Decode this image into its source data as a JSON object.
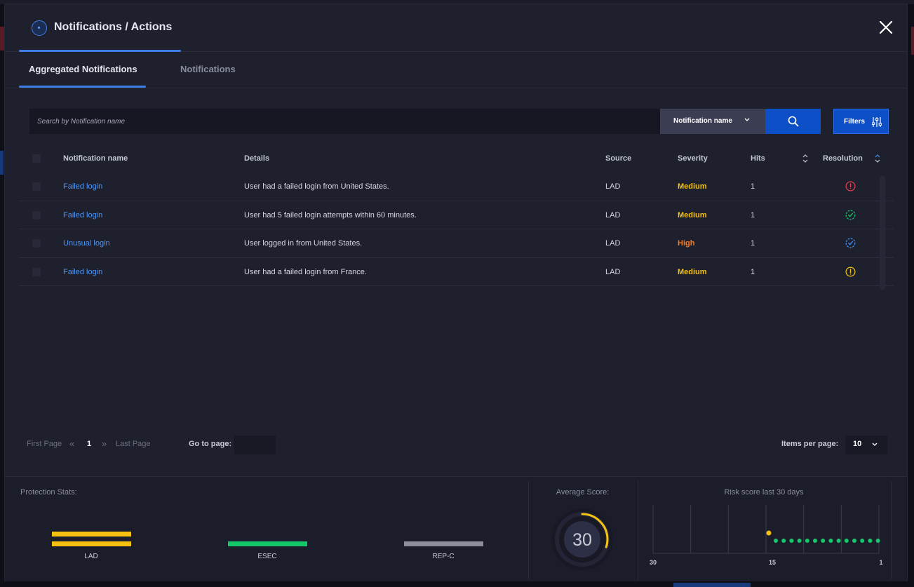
{
  "header": {
    "title": "Notifications / Actions"
  },
  "tabs": [
    {
      "label": "Aggregated Notifications",
      "active": true
    },
    {
      "label": "Notifications",
      "active": false
    }
  ],
  "search": {
    "placeholder": "Search by Notification name",
    "field_select": "Notification name",
    "filters_label": "Filters"
  },
  "table": {
    "columns": {
      "name": "Notification name",
      "details": "Details",
      "source": "Source",
      "severity": "Severity",
      "hits": "Hits",
      "resolution": "Resolution"
    },
    "rows": [
      {
        "name": "Failed login",
        "details": "User had a failed login from United States.",
        "source": "LAD",
        "severity": "Medium",
        "hits": "1",
        "resolution_icon": "alert-circle-icon",
        "resolution_color": "#e0434f"
      },
      {
        "name": "Failed login",
        "details": "User had 5 failed login attempts within 60 minutes.",
        "source": "LAD",
        "severity": "Medium",
        "hits": "1",
        "resolution_icon": "check-circle-dashed-icon",
        "resolution_color": "#19c26a"
      },
      {
        "name": "Unusual login",
        "details": "User logged in from United States.",
        "source": "LAD",
        "severity": "High",
        "hits": "1",
        "resolution_icon": "check-circle-dashed-icon",
        "resolution_color": "#3d8ff0"
      },
      {
        "name": "Failed login",
        "details": "User had a failed login from France.",
        "source": "LAD",
        "severity": "Medium",
        "hits": "1",
        "resolution_icon": "alert-circle-icon",
        "resolution_color": "#f2c811"
      }
    ],
    "severity_colors": {
      "Medium": "#f5c211",
      "High": "#f57c1f"
    }
  },
  "pagination": {
    "first_label": "First Page",
    "current_page": "1",
    "last_label": "Last Page",
    "goto_label": "Go to page:",
    "items_label": "Items per page:",
    "items_value": "10"
  },
  "stats": {
    "protection_label": "Protection Stats:",
    "bars": [
      {
        "label": "LAD",
        "color": "#f5c211",
        "double": true
      },
      {
        "label": "ESEC",
        "color": "#14c76a",
        "double": false
      },
      {
        "label": "REP-C",
        "color": "#8c8e99",
        "double": false
      }
    ],
    "average_label": "Average Score:",
    "average_score": "30",
    "average_fraction": 0.3,
    "gauge_color": "#f5c211",
    "risk_label": "Risk score last 30 days",
    "risk_ticks": [
      "30",
      "15",
      "1"
    ],
    "risk_marker_color": "#f5c211",
    "risk_point_color": "#14c76a"
  }
}
